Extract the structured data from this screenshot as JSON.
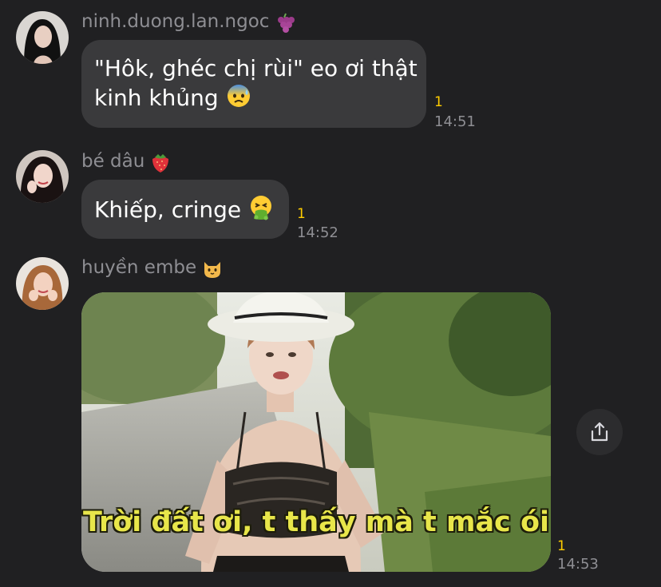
{
  "messages": [
    {
      "sender": "ninh.duong.lan.ngoc",
      "sender_emoji": "grapes-icon",
      "text_line1": "\"Hôk, ghéc chị rùi\" eo ơi thật",
      "text_line2": "kinh khủng",
      "inline_emoji": "anxious-face-with-sweat-icon",
      "seen": "1",
      "time": "14:51"
    },
    {
      "sender": "bé dâu",
      "sender_emoji": "strawberry-icon",
      "text": "Khiếp, cringe",
      "inline_emoji": "vomiting-face-icon",
      "seen": "1",
      "time": "14:52"
    },
    {
      "sender": "huyền embe",
      "sender_emoji": "cat-face-icon",
      "gif_caption": "Trời đất ơi, t thấy mà t mắc ói",
      "seen": "1",
      "time": "14:53"
    }
  ],
  "share_button": {
    "icon": "share-upload-icon"
  },
  "colors": {
    "background": "#202022",
    "bubble": "#3a3a3c",
    "sender_text": "#8e8e93",
    "seen_indicator": "#ffcc00",
    "caption": "#e8e64a"
  }
}
